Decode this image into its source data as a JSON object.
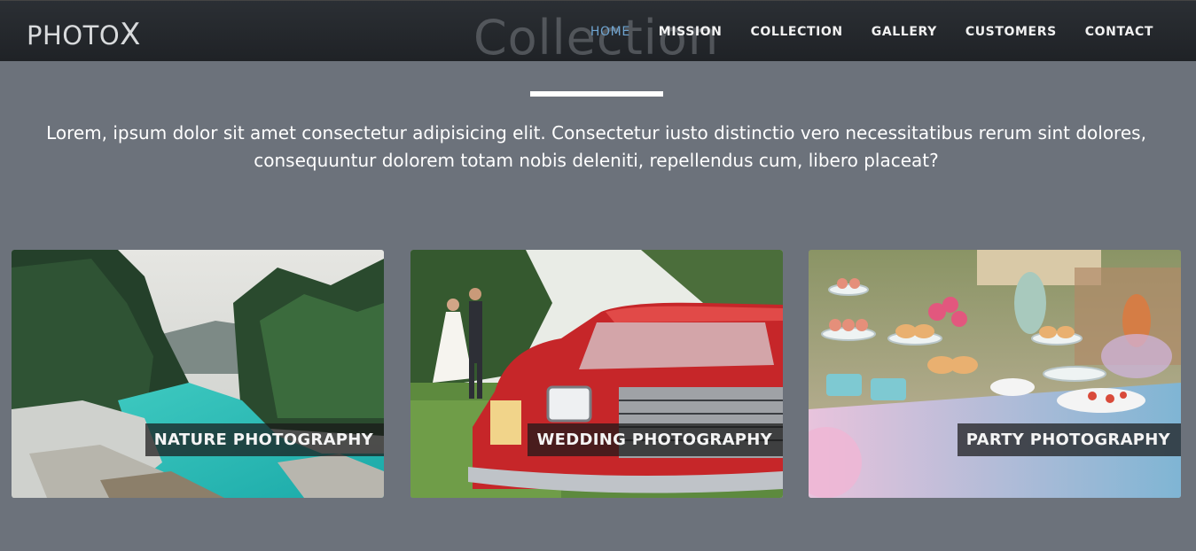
{
  "brand": {
    "text": "PHOTO",
    "x": "X"
  },
  "nav": {
    "items": [
      {
        "label": "HOME",
        "active": true
      },
      {
        "label": "MISSION",
        "active": false
      },
      {
        "label": "COLLECTION",
        "active": false
      },
      {
        "label": "GALLERY",
        "active": false
      },
      {
        "label": "CUSTOMERS",
        "active": false
      },
      {
        "label": "CONTACT",
        "active": false
      }
    ],
    "active_color": "#6fa4d0"
  },
  "section": {
    "title": "Collection",
    "intro": "Lorem, ipsum dolor sit amet consectetur adipisicing elit. Consectetur iusto distinctio vero necessitatibus rerum sint dolores, consequuntur dolorem totam nobis deleniti, repellendus cum, libero placeat?"
  },
  "cards": [
    {
      "caption": "NATURE PHOTOGRAPHY",
      "image": "river-forest-photo"
    },
    {
      "caption": "WEDDING PHOTOGRAPHY",
      "image": "wedding-red-car-photo"
    },
    {
      "caption": "PARTY PHOTOGRAPHY",
      "image": "party-dessert-table-photo"
    }
  ],
  "colors": {
    "background": "#6c727b",
    "navbar": "#23272b"
  }
}
